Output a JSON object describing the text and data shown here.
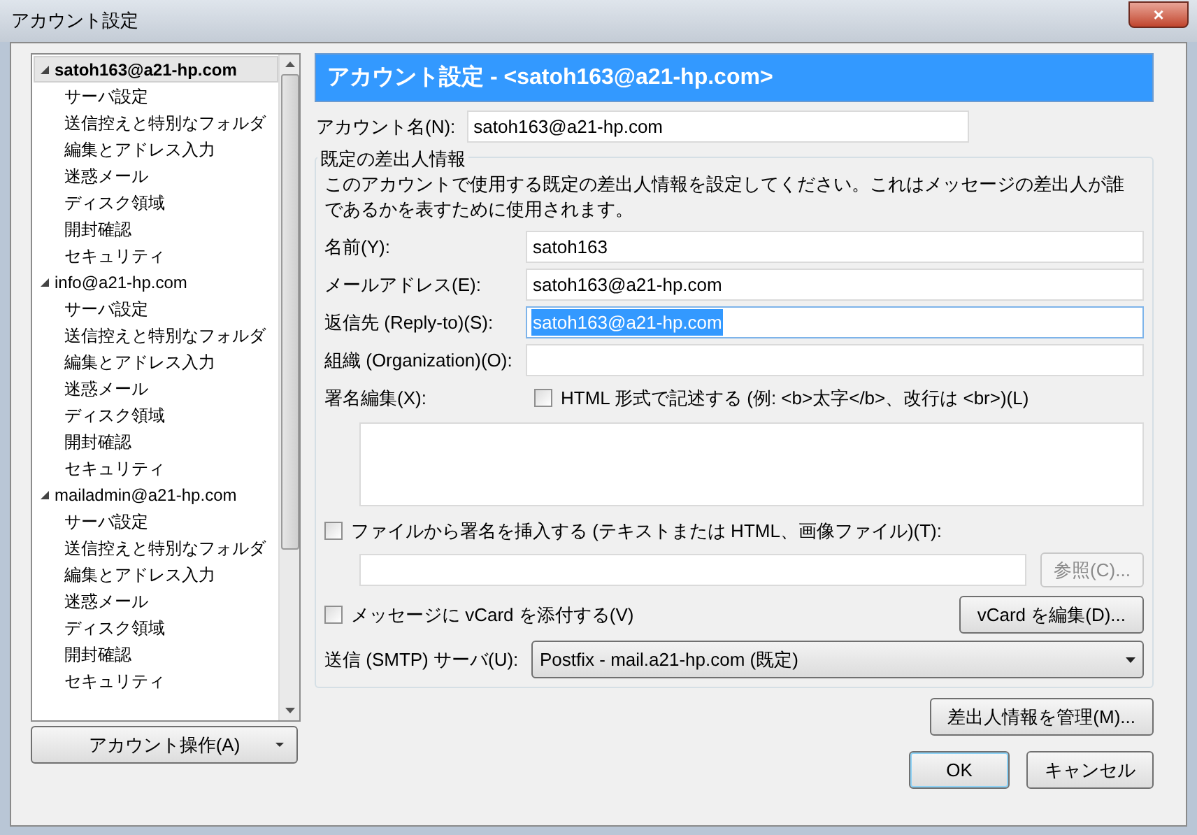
{
  "window": {
    "title": "アカウント設定",
    "close": "×"
  },
  "tree": [
    {
      "label": "satoh163@a21-hp.com",
      "selected": true,
      "expanded": true,
      "children": [
        {
          "label": "サーバ設定"
        },
        {
          "label": "送信控えと特別なフォルダ"
        },
        {
          "label": "編集とアドレス入力"
        },
        {
          "label": "迷惑メール"
        },
        {
          "label": "ディスク領域"
        },
        {
          "label": "開封確認"
        },
        {
          "label": "セキュリティ"
        }
      ]
    },
    {
      "label": "info@a21-hp.com",
      "selected": false,
      "expanded": true,
      "children": [
        {
          "label": "サーバ設定"
        },
        {
          "label": "送信控えと特別なフォルダ"
        },
        {
          "label": "編集とアドレス入力"
        },
        {
          "label": "迷惑メール"
        },
        {
          "label": "ディスク領域"
        },
        {
          "label": "開封確認"
        },
        {
          "label": "セキュリティ"
        }
      ]
    },
    {
      "label": "mailadmin@a21-hp.com",
      "selected": false,
      "expanded": true,
      "children": [
        {
          "label": "サーバ設定"
        },
        {
          "label": "送信控えと特別なフォルダ"
        },
        {
          "label": "編集とアドレス入力"
        },
        {
          "label": "迷惑メール"
        },
        {
          "label": "ディスク領域"
        },
        {
          "label": "開封確認"
        },
        {
          "label": "セキュリティ"
        }
      ]
    }
  ],
  "account_actions": {
    "label": "アカウント操作(A)"
  },
  "header": "アカウント設定 - <satoh163@a21-hp.com>",
  "account_name": {
    "label": "アカウント名(N):",
    "value": "satoh163@a21-hp.com"
  },
  "identity": {
    "legend": "既定の差出人情報",
    "description": "このアカウントで使用する既定の差出人情報を設定してください。これはメッセージの差出人が誰であるかを表すために使用されます。",
    "fields": [
      {
        "label": "名前(Y):",
        "value": "satoh163",
        "text_selected": false
      },
      {
        "label": "メールアドレス(E):",
        "value": "satoh163@a21-hp.com",
        "text_selected": false
      },
      {
        "label": "返信先 (Reply-to)(S):",
        "value": "satoh163@a21-hp.com",
        "text_selected": true
      },
      {
        "label": "組織 (Organization)(O):",
        "text_selected": false
      }
    ],
    "signature_label": "署名編集(X):",
    "html_checkbox": {
      "label": "HTML 形式で記述する (例: <b>太字</b>、改行は <br>)(L)",
      "checked": false
    },
    "file_checkbox": {
      "label": "ファイルから署名を挿入する (テキストまたは HTML、画像ファイル)(T):",
      "checked": false
    },
    "browse_button": {
      "label": "参照(C)...",
      "disabled": true
    },
    "vcard_checkbox": {
      "label": "メッセージに vCard を添付する(V)",
      "checked": false
    },
    "vcard_button": {
      "label": "vCard を編集(D)..."
    },
    "smtp": {
      "label": "送信 (SMTP) サーバ(U):",
      "value": "Postfix - mail.a21-hp.com (既定)"
    }
  },
  "manage_button": {
    "label": "差出人情報を管理(M)..."
  },
  "buttons": [
    {
      "label": "OK",
      "default": true
    },
    {
      "label": "キャンセル",
      "default": false
    }
  ]
}
